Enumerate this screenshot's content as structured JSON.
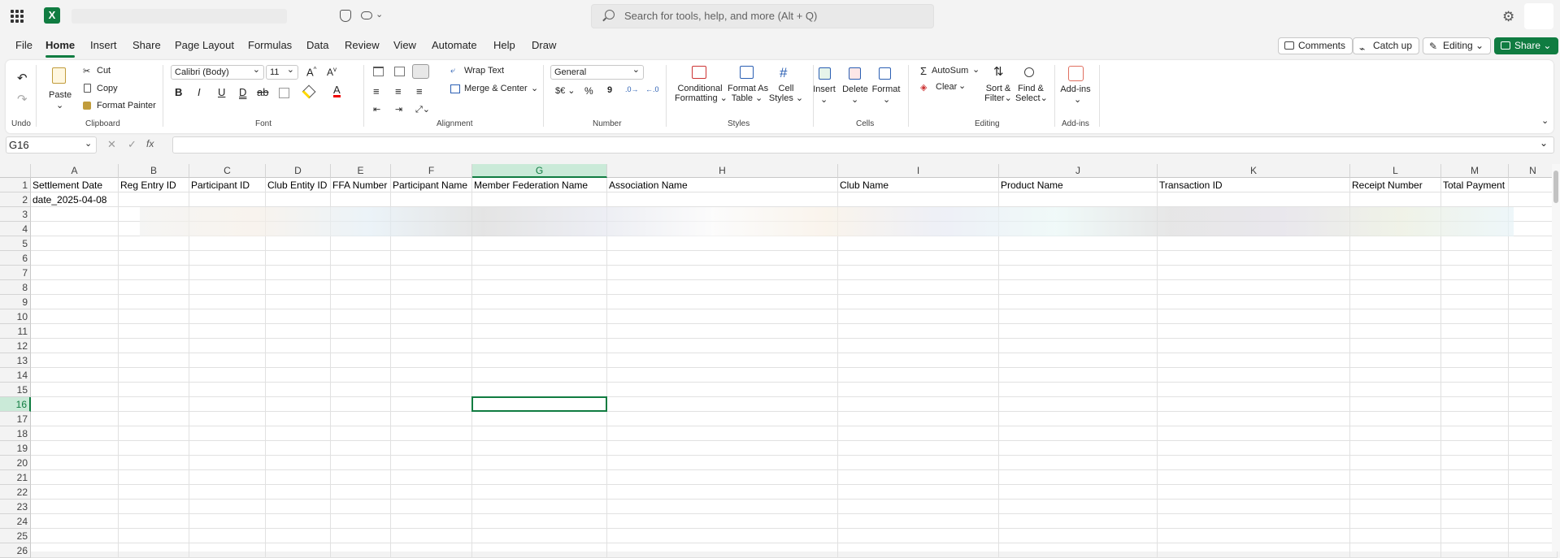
{
  "app": {
    "logo_letter": "X"
  },
  "search": {
    "placeholder": "Search for tools, help, and more (Alt + Q)"
  },
  "menu": {
    "items": [
      "File",
      "Home",
      "Insert",
      "Share",
      "Page Layout",
      "Formulas",
      "Data",
      "Review",
      "View",
      "Automate",
      "Help",
      "Draw"
    ],
    "active": "Home"
  },
  "toolbar_right": {
    "comments": "Comments",
    "catchup": "Catch up",
    "editing": "Editing",
    "share": "Share"
  },
  "ribbon": {
    "undo_group": "Undo",
    "clipboard": {
      "paste": "Paste",
      "cut": "Cut",
      "copy": "Copy",
      "format_painter": "Format Painter",
      "group": "Clipboard"
    },
    "font": {
      "family": "Calibri (Body)",
      "size": "11",
      "group": "Font"
    },
    "alignment": {
      "wrap": "Wrap Text",
      "merge": "Merge & Center",
      "group": "Alignment"
    },
    "number": {
      "format": "General",
      "group": "Number"
    },
    "styles": {
      "cond": [
        "Conditional",
        "Formatting"
      ],
      "table": [
        "Format As",
        "Table"
      ],
      "cell": [
        "Cell",
        "Styles"
      ],
      "group": "Styles"
    },
    "cells": {
      "insert": "Insert",
      "delete": "Delete",
      "format": "Format",
      "group": "Cells"
    },
    "editing": {
      "autosum": "AutoSum",
      "clear": "Clear",
      "sort": [
        "Sort &",
        "Filter"
      ],
      "find": [
        "Find &",
        "Select"
      ],
      "group": "Editing"
    },
    "addins": {
      "label": "Add-ins",
      "group": "Add-ins"
    }
  },
  "formula_bar": {
    "name_box": "G16",
    "fx": "fx",
    "value": ""
  },
  "sheet": {
    "columns": [
      "A",
      "B",
      "C",
      "D",
      "E",
      "F",
      "G",
      "H",
      "I",
      "J",
      "K",
      "L",
      "M",
      "N"
    ],
    "selected_column": "G",
    "selected_row": "16",
    "rows": [
      "1",
      "2",
      "3",
      "4",
      "5",
      "6",
      "7",
      "8",
      "9",
      "10",
      "11",
      "12",
      "13",
      "14",
      "15",
      "16",
      "17",
      "18",
      "19",
      "20",
      "21",
      "22",
      "23",
      "24",
      "25",
      "26"
    ],
    "header_row": [
      "Settlement Date",
      "Reg Entry ID",
      "Participant ID",
      "Club Entity ID",
      "FFA Number",
      "Participant Name",
      "Member Federation Name",
      "Association Name",
      "Club Name",
      "Product Name",
      "Transaction ID",
      "Receipt Number",
      "Total Payment",
      ""
    ],
    "row2": [
      "date_2025-04-08",
      "",
      "",
      "",
      "",
      "",
      "",
      "",
      "",
      "",
      "",
      "",
      "",
      ""
    ]
  },
  "colors": {
    "accent": "#107c41",
    "selected_header": "#caead8"
  }
}
